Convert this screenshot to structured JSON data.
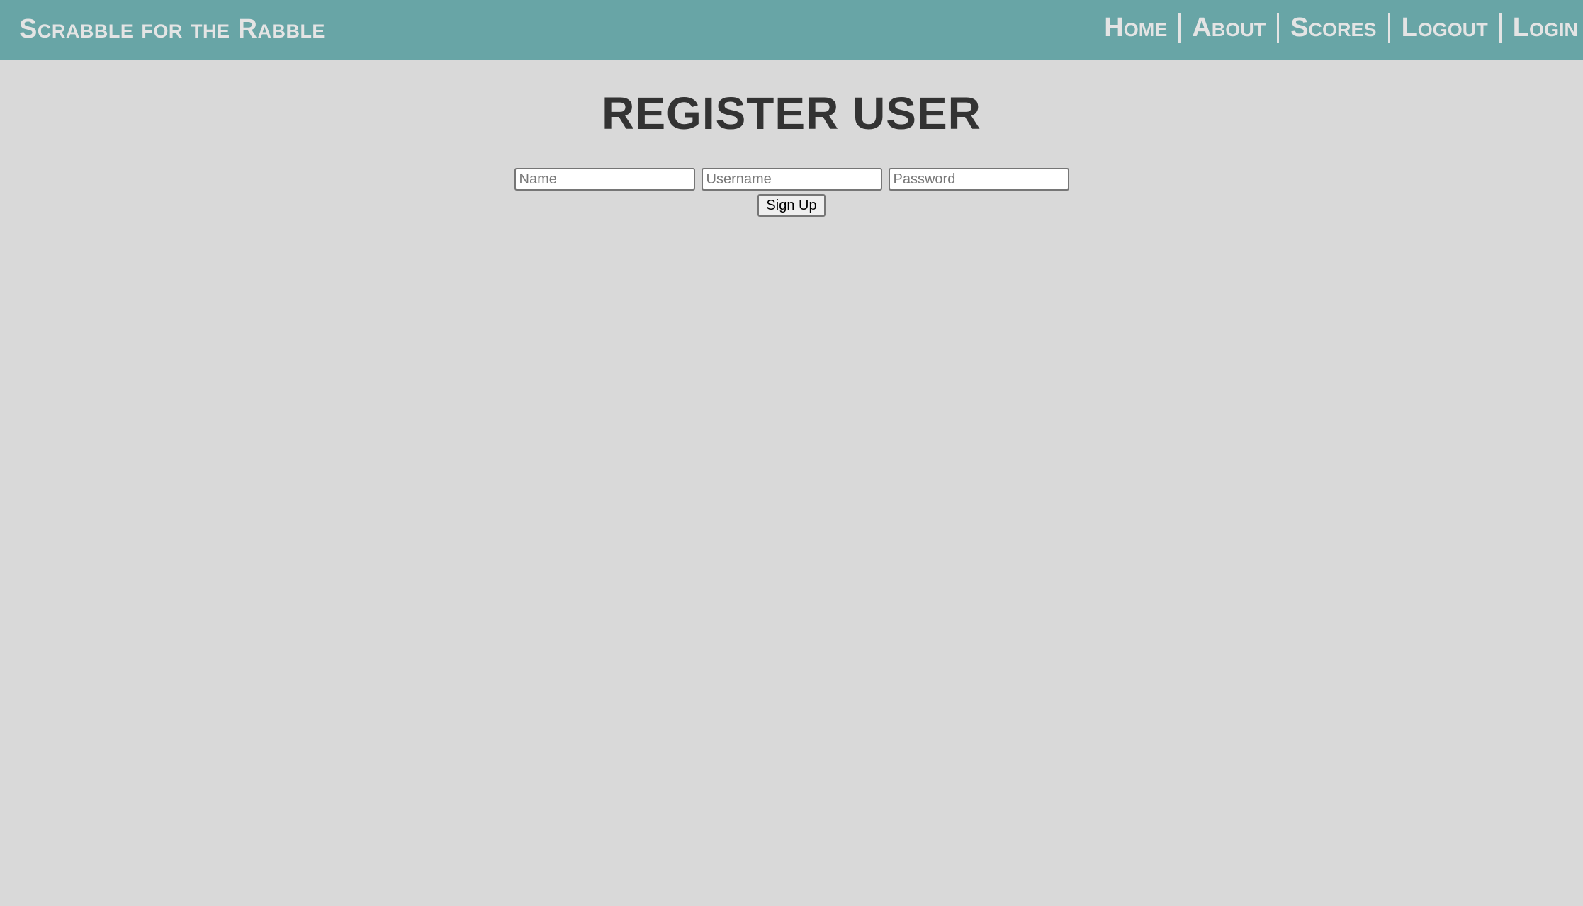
{
  "navbar": {
    "brand": "Scrabble for the Rabble",
    "links": [
      {
        "label": "Home"
      },
      {
        "label": "About"
      },
      {
        "label": "Scores"
      },
      {
        "label": "Logout"
      },
      {
        "label": "Login"
      }
    ],
    "background_color": "#68a5a6",
    "text_color": "#e4e4e4"
  },
  "page": {
    "title": "REGISTER USER",
    "background_color": "#d9d9d9"
  },
  "form": {
    "name_placeholder": "Name",
    "name_value": "",
    "username_placeholder": "Username",
    "username_value": "",
    "password_placeholder": "Password",
    "password_value": "",
    "submit_label": "Sign Up"
  }
}
